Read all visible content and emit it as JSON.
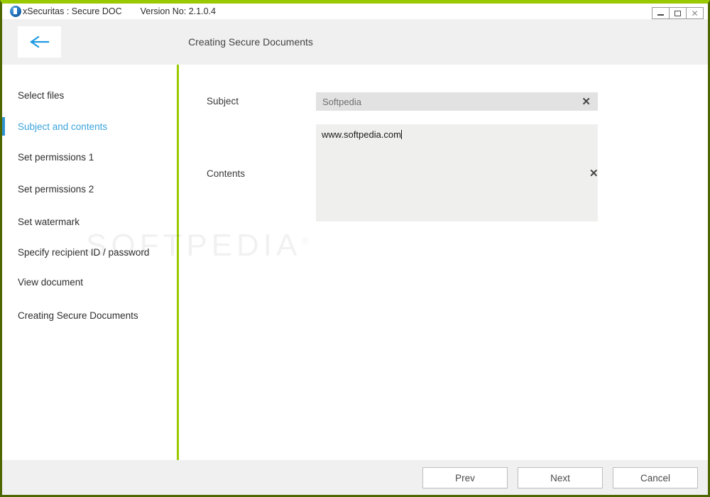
{
  "window": {
    "title": "xSecuritas : Secure DOC",
    "version": "Version No: 2.1.0.4",
    "app_icon": "document-shield-icon",
    "controls": {
      "minimize": "minimize-icon",
      "maximize": "maximize-icon",
      "close": "✕"
    },
    "colors": {
      "border_top": "#9ac900",
      "border_side": "#4d6600",
      "accent_green": "#9ac900",
      "accent_blue": "#3ba3dd",
      "header_band": "#f0f0f0"
    }
  },
  "header": {
    "back_icon": "arrow-left-icon",
    "title": "Creating Secure Documents"
  },
  "sidebar": {
    "items": [
      {
        "label": "Select files",
        "active": false
      },
      {
        "label": "Subject and contents",
        "active": true
      },
      {
        "label": "Set permissions 1",
        "active": false
      },
      {
        "label": "Set permissions 2",
        "active": false
      },
      {
        "label": "Set watermark",
        "active": false
      },
      {
        "label": "Specify recipient ID / password",
        "active": false
      },
      {
        "label": "View document",
        "active": false
      },
      {
        "label": "Creating Secure Documents",
        "active": false
      }
    ]
  },
  "form": {
    "subject": {
      "label": "Subject",
      "value": "Softpedia",
      "clear_icon": "✕"
    },
    "contents": {
      "label": "Contents",
      "value": "www.softpedia.com",
      "clear_icon": "✕"
    }
  },
  "watermark": {
    "text": "SOFTPEDIA",
    "mark": "®"
  },
  "footer": {
    "buttons": [
      {
        "label": "Prev"
      },
      {
        "label": "Next"
      },
      {
        "label": "Cancel"
      }
    ]
  }
}
